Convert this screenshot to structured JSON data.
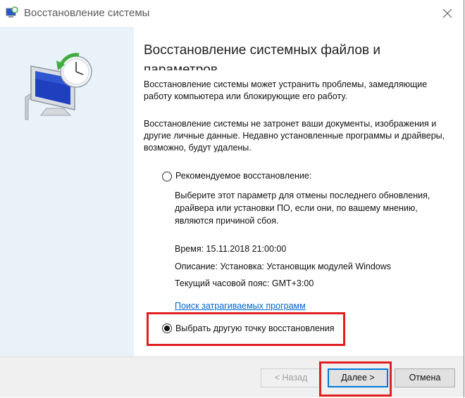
{
  "window": {
    "title": "Восстановление системы"
  },
  "content": {
    "heading": "Восстановление системных файлов и параметров",
    "paragraph1": "Восстановление системы может устранить проблемы, замедляющие работу компьютера или блокирующие его работу.",
    "paragraph2": "Восстановление системы не затронет ваши документы, изображения и другие личные данные. Недавно установленные программы и драйверы, возможно, будут удалены."
  },
  "options": {
    "recommended": {
      "label": "Рекомендуемое восстановление:",
      "checked": false,
      "description": "Выберите этот параметр для отмены последнего обновления, драйвера или установки ПО, если они, по вашему мнению, являются причиной сбоя.",
      "time": "Время: 15.11.2018 21:00:00",
      "description_line": "Описание: Установка: Установщик модулей Windows",
      "timezone": "Текущий часовой пояс: GMT+3:00",
      "link": "Поиск затрагиваемых программ"
    },
    "other": {
      "label": "Выбрать другую точку восстановления",
      "checked": true
    }
  },
  "buttons": {
    "back": "< Назад",
    "next": "Далее >",
    "cancel": "Отмена"
  },
  "colors": {
    "highlight": "#e02020",
    "link": "#0066cc",
    "banner": "#e9f1f9"
  }
}
